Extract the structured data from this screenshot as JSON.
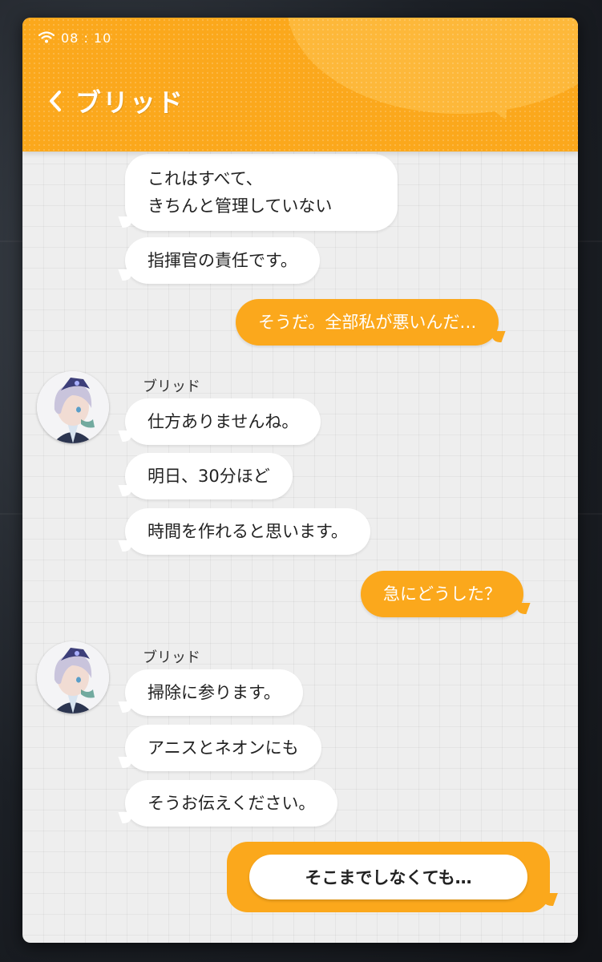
{
  "status_bar": {
    "time": "08 : 10",
    "wifi_icon": "wifi-icon"
  },
  "header": {
    "back_icon": "chevron-left-icon",
    "title": "ブリッド",
    "accent": "#fba81c"
  },
  "messages": [
    {
      "side": "in",
      "text": "これはすべて、\nきちんと管理していない"
    },
    {
      "side": "in",
      "text": "指揮官の責任です。"
    },
    {
      "side": "out",
      "text": "そうだ。全部私が悪いんだ…"
    },
    {
      "side": "in",
      "sender": "ブリッド",
      "text": "仕方ありませんね。"
    },
    {
      "side": "in",
      "text": "明日、30分ほど"
    },
    {
      "side": "in",
      "text": "時間を作れると思います。"
    },
    {
      "side": "out",
      "text": "急にどうした？"
    },
    {
      "side": "in",
      "sender": "ブリッド",
      "text": "掃除に参ります。"
    },
    {
      "side": "in",
      "text": "アニスとネオンにも"
    },
    {
      "side": "in",
      "text": "そうお伝えください。"
    }
  ],
  "reply_option": {
    "label": "そこまでしなくても…"
  },
  "colors": {
    "outgoing_bubble": "#fba81c",
    "incoming_bubble": "#ffffff",
    "chat_bg": "#eeeeee"
  }
}
